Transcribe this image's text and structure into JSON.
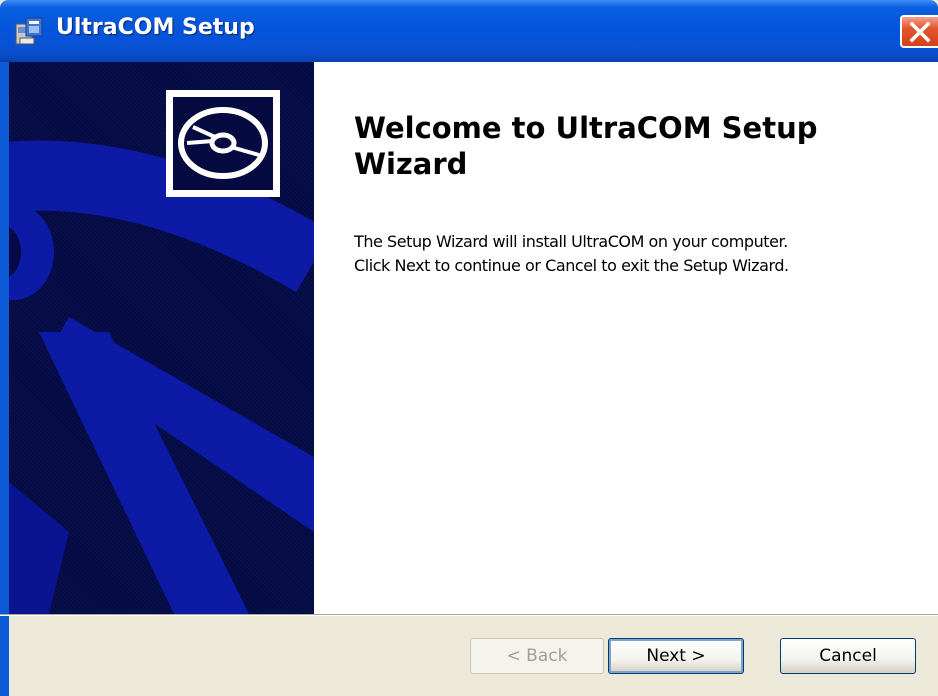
{
  "window": {
    "title": "UltraCOM Setup",
    "close_icon": "close-icon"
  },
  "wizard": {
    "heading": "Welcome to UltraCOM Setup Wizard",
    "description_line1": "The Setup Wizard will install UltraCOM on your computer.",
    "description_line2": "Click Next to continue or Cancel to exit the Setup Wizard.",
    "banner_icon": "cd-disc-icon"
  },
  "buttons": {
    "back_label": "< Back",
    "back_enabled": false,
    "next_label": "Next >",
    "cancel_label": "Cancel"
  },
  "colors": {
    "title_bar": "#0454dc",
    "banner": "#030a44",
    "close_button": "#e3552c",
    "footer": "#ece9d8"
  }
}
